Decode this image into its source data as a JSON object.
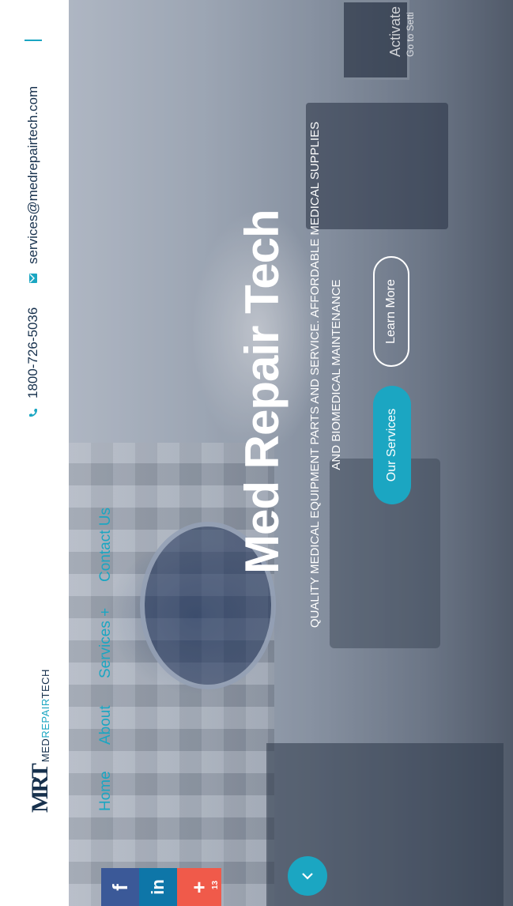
{
  "contact": {
    "phone": "1800-726-5036",
    "email": "services@medrepairtech.com",
    "phone_icon": "phone-icon",
    "email_icon": "email-icon"
  },
  "logo": {
    "mark": "MRT",
    "word_a": "MED",
    "word_b": "REPAIR",
    "word_c": "TECH"
  },
  "nav": {
    "home": "Home",
    "about": "About",
    "services": "Services +",
    "contact": "Contact Us"
  },
  "hero": {
    "title": "Med Repair Tech",
    "subtitle": "QUALITY MEDICAL EQUIPMENT PARTS AND SERVICE. AFFORDABLE MEDICAL SUPPLIES AND BIOMEDICAL MAINTENANCE",
    "learn_more": "Learn More",
    "our_services": "Our Services"
  },
  "watermark": {
    "line1": "Activate",
    "line2": "Go to Setti"
  },
  "share": {
    "facebook": "f",
    "linkedin": "in",
    "more": "+",
    "count": "13"
  },
  "colors": {
    "accent": "#1ba6c2",
    "navy": "#17314d",
    "facebook": "#3b5998",
    "linkedin": "#0e76a8",
    "more": "#f05a4a"
  }
}
